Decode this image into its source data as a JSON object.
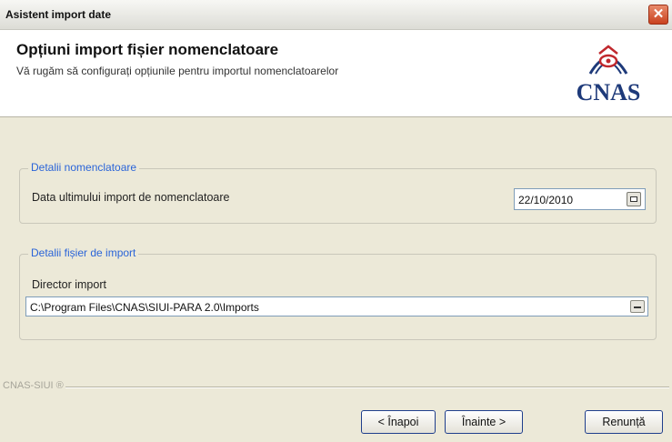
{
  "window": {
    "title": "Asistent import date",
    "close_glyph": "✕"
  },
  "header": {
    "title": "Opțiuni import fișier nomenclatoare",
    "subtitle": "Vă rugăm să configurați opțiunile pentru importul nomenclatoarelor",
    "logo_text": "CNAS",
    "logo_icon": "cnas-logo-icon"
  },
  "group_nomenclatoare": {
    "legend": "Detalii nomenclatoare",
    "date_label": "Data ultimului import de nomenclatoare",
    "date_value": "22/10/2010",
    "date_icon": "calendar-icon"
  },
  "group_fisier": {
    "legend": "Detalii fișier de import",
    "dir_label": "Director import",
    "dir_value": "C:\\Program Files\\CNAS\\SIUI-PARA 2.0\\Imports",
    "browse_icon": "browse-icon"
  },
  "footer": {
    "product_label": "CNAS-SIUI ®",
    "back_label": "< Înapoi",
    "next_label": "Înainte >",
    "cancel_label": "Renunță"
  },
  "colors": {
    "accent": "#2a64d8",
    "logo": "#1e3a7a",
    "close": "#c9421f"
  }
}
